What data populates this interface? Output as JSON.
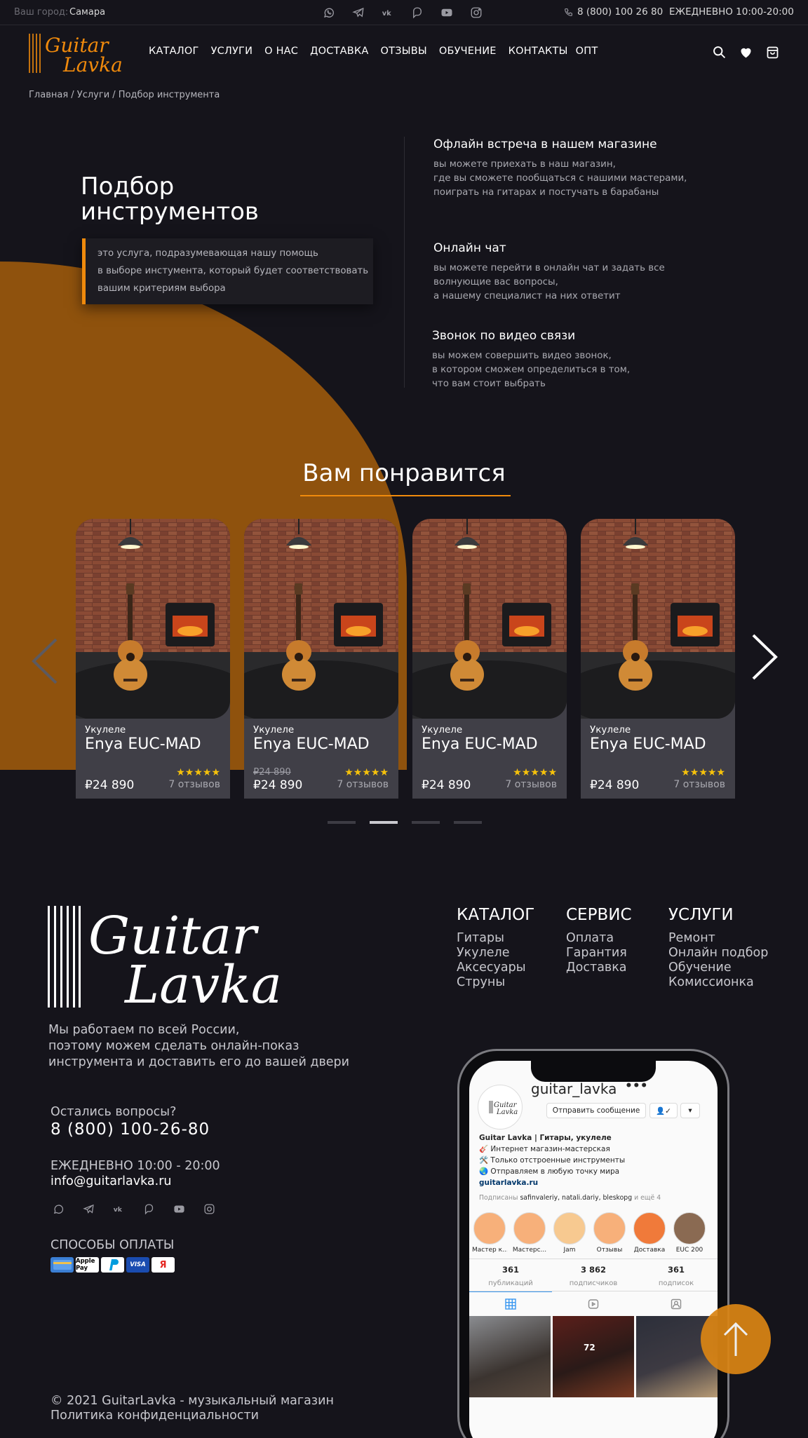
{
  "topbar": {
    "city_label": "Ваш город:",
    "city": "Самара",
    "socials": [
      "whatsapp-icon",
      "telegram-icon",
      "vk-icon",
      "viber-icon",
      "youtube-icon",
      "instagram-icon"
    ],
    "phone": "8 (800) 100 26 80",
    "hours": "ЕЖЕДНЕВНО  10:00-20:00"
  },
  "brand": {
    "line1": "Guitar",
    "line2": "Lavka",
    "accent": "#f08a0c"
  },
  "nav": [
    "КАТАЛОГ",
    "УСЛУГИ",
    "О НАС",
    "ДОСТАВКА",
    "ОТЗЫВЫ",
    "ОБУЧЕНИЕ",
    "КОНТАКТЫ",
    "ОПТ"
  ],
  "header_icons": [
    "search-icon",
    "heart-icon",
    "cart-icon"
  ],
  "breadcrumb": "Главная / Услуги / Подбор инструмента",
  "hero": {
    "title_line1": "Подбор",
    "title_line2": "инструментов",
    "desc_line1": "это услуга, подразумевающая нашу помощь",
    "desc_line2": "в выборе инстумента, который будет соответствовать",
    "desc_line3": "вашим критериям выбора"
  },
  "features": [
    {
      "title": "Офлайн встреча в нашем магазине",
      "l1": "вы можете приехать в наш магазин,",
      "l2": "где вы сможете пообщаться с нашими мастерами,",
      "l3": "поиграть на гитарах и постучать в барабаны"
    },
    {
      "title": "Онлайн чат",
      "l1": "вы можете перейти в онлайн чат и задать все",
      "l2": "волнующие вас вопросы,",
      "l3": "а нашему специалист на них ответит"
    },
    {
      "title": "Звонок по видео связи",
      "l1": "вы можем совершить видео звонок,",
      "l2": "в котором сможем определиться в том,",
      "l3": "что вам стоит выбрать"
    }
  ],
  "recommend": {
    "title": "Вам понравится",
    "cards": [
      {
        "category": "Укулеле",
        "name": "Enya EUC-MAD",
        "old_price": "",
        "price": "₽24 890",
        "stars": "★★★★★",
        "reviews": "7 отзывов"
      },
      {
        "category": "Укулеле",
        "name": "Enya EUC-MAD",
        "old_price": "₽24 890",
        "price": "₽24 890",
        "stars": "★★★★★",
        "reviews": "7 отзывов"
      },
      {
        "category": "Укулеле",
        "name": "Enya EUC-MAD",
        "old_price": "",
        "price": "₽24 890",
        "stars": "★★★★★",
        "reviews": "7 отзывов"
      },
      {
        "category": "Укулеле",
        "name": "Enya EUC-MAD",
        "old_price": "",
        "price": "₽24 890",
        "stars": "★★★★★",
        "reviews": "7 отзывов"
      }
    ],
    "active_dot": 2,
    "dot_count": 4
  },
  "footer": {
    "desc_l1": "Мы работаем по всей России,",
    "desc_l2": "поэтому можем сделать онлайн-показ",
    "desc_l3": "инструмента и доставить его до вашей двери",
    "question": "Остались вопросы?",
    "phone": "8 (800) 100-26-80",
    "hours": "ЕЖЕДНЕВНО 10:00 - 20:00",
    "email": "info@guitarlavka.ru",
    "payment_title": "СПОСОБЫ ОПЛАТЫ",
    "payments": [
      "card",
      "Apple Pay",
      "PayPal",
      "VISA",
      "Я"
    ],
    "copyright": "© 2021 GuitarLavka - музыкальный магазин",
    "privacy": "Политика конфиденциальности",
    "columns": [
      {
        "title": "КАТАЛОГ",
        "items": [
          "Гитары",
          "Укулеле",
          "Аксесуары",
          "Струны"
        ]
      },
      {
        "title": "СЕРВИС",
        "items": [
          "Оплата",
          "Гарантия",
          "Доставка"
        ]
      },
      {
        "title": "УСЛУГИ",
        "items": [
          "Ремонт",
          "Онлайн подбор",
          "Обучение",
          "Комиссионка"
        ]
      }
    ]
  },
  "instagram": {
    "username": "guitar_lavka",
    "message_btn": "Отправить сообщение",
    "bio_title": "Guitar Lavka | Гитары, укулеле",
    "bio_l1": "🎸 Интернет магазин-мастерская",
    "bio_l2": "🛠️ Только отстроенные инструменты",
    "bio_l3": "🌏 Отправляем в любую точку мира",
    "link": "guitarlavka.ru",
    "followed_prefix": "Подписаны",
    "followed_names": "safinvaleriy, natali.dariy, bleskopg",
    "followed_suffix": "и ещё 4",
    "highlights": [
      "Мастер к...",
      "Мастерс...",
      "Jam",
      "Отзывы",
      "Доставка",
      "EUC 200"
    ],
    "stats": [
      {
        "value": "361",
        "label": "публикаций"
      },
      {
        "value": "3 862",
        "label": "подписчиков"
      },
      {
        "value": "361",
        "label": "подписок"
      }
    ],
    "likes": "72"
  }
}
